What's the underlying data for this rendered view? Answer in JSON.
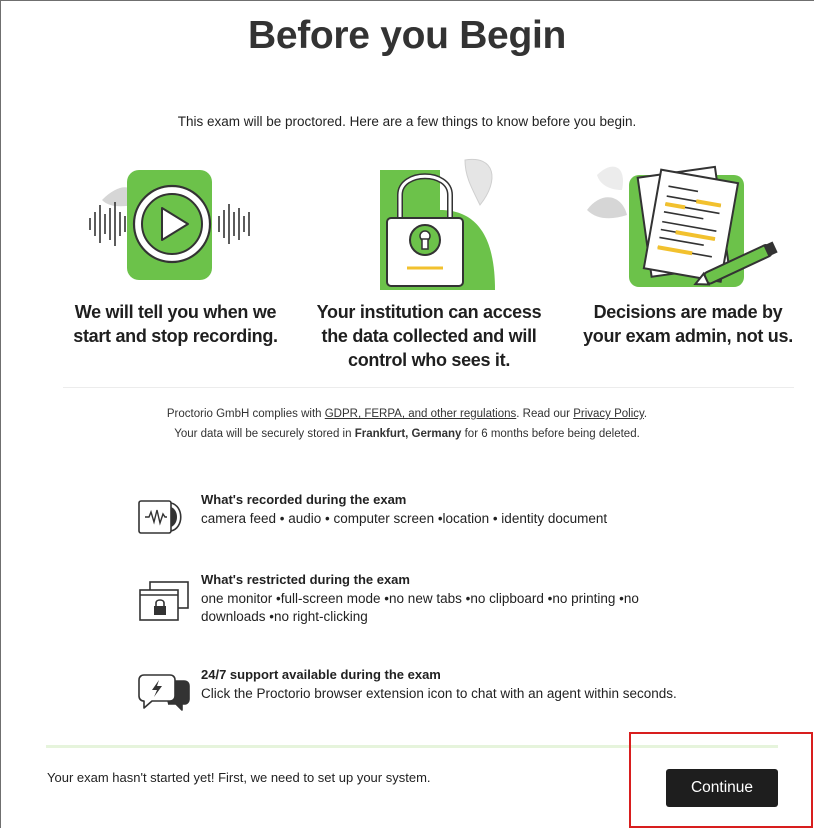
{
  "page": {
    "title": "Before you Begin",
    "intro": "This exam will be proctored. Here are a few things to know before you begin."
  },
  "features": [
    {
      "caption_lines": [
        "We will tell you when we",
        "start and stop recording."
      ],
      "icon": "play-recording-icon"
    },
    {
      "caption_lines": [
        "Your institution can access",
        "the data collected and will",
        "control who sees it."
      ],
      "icon": "padlock-icon"
    },
    {
      "caption_lines": [
        "Decisions are made by",
        "your exam admin, not us."
      ],
      "icon": "document-pen-icon"
    }
  ],
  "legal": {
    "line1_prefix": "Proctorio GmbH complies with ",
    "line1_link1": "GDPR, FERPA, and other regulations",
    "line1_mid": ". Read our ",
    "line1_link2": "Privacy Policy",
    "line1_suffix": ".",
    "line2_prefix": "Your data will be securely stored in ",
    "line2_bold": "Frankfurt, Germany",
    "line2_suffix": " for 6 months before being deleted."
  },
  "info": [
    {
      "heading": "What's recorded during the exam",
      "body": "camera feed • audio • computer screen •location • identity document",
      "icon": "recording-waveform-icon"
    },
    {
      "heading": "What's restricted during the exam",
      "body": "one monitor •full-screen mode •no new tabs •no clipboard •no printing •no downloads •no right-clicking",
      "icon": "locked-windows-icon"
    },
    {
      "heading": "24/7 support available during the exam",
      "body": "Click the Proctorio browser extension icon to chat with an agent within seconds.",
      "icon": "chat-bolt-icon"
    }
  ],
  "footer": {
    "status": "Your exam hasn't started yet! First, we need to set up your system.",
    "continue_label": "Continue"
  },
  "colors": {
    "accent_green": "#6cc24a",
    "button_dark": "#1e1e1e",
    "highlight_red": "#d81e1e",
    "leaf_gray": "#d6d6d6",
    "doc_yellow": "#f2c12e"
  }
}
